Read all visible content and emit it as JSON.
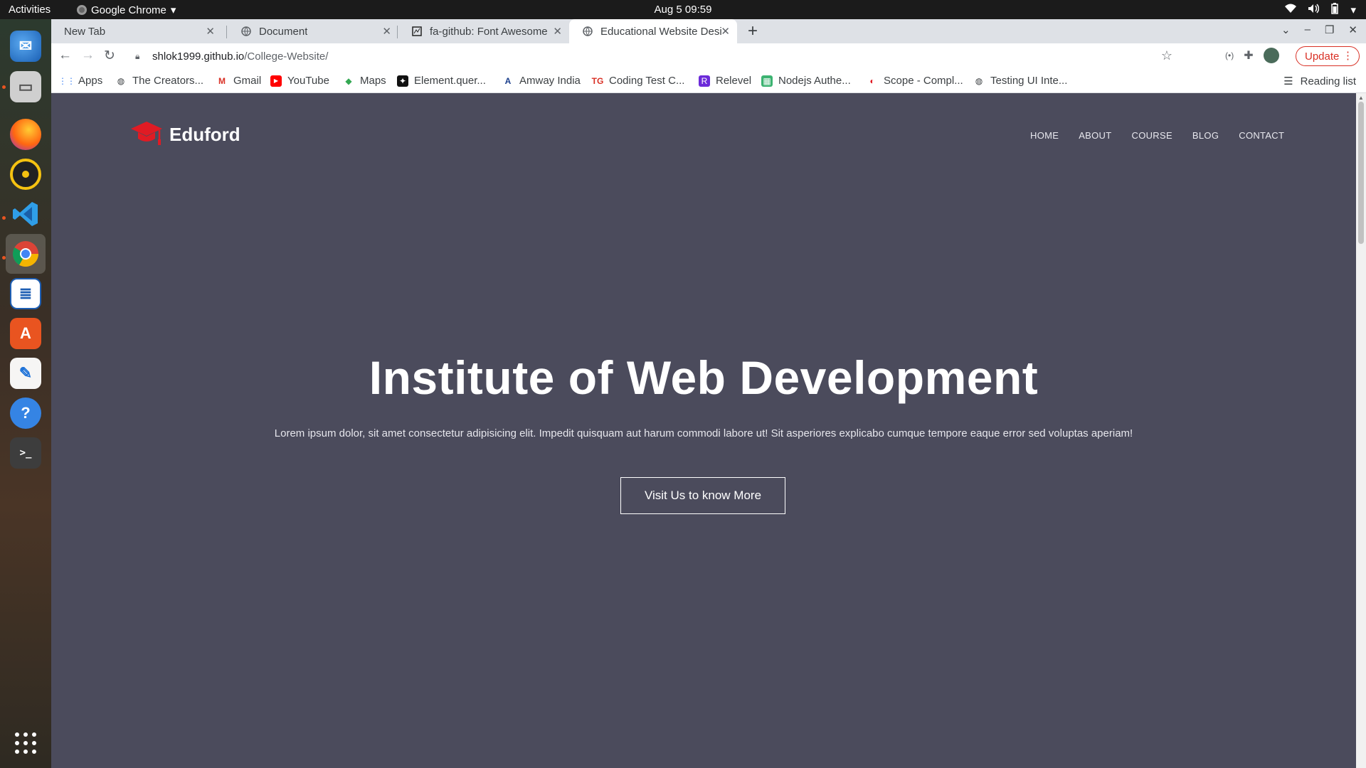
{
  "os": {
    "activities": "Activities",
    "app_name": "Google Chrome",
    "clock": "Aug 5  09:59",
    "tray": [
      "wifi-icon",
      "volume-icon",
      "battery-icon",
      "menu-arrow-icon"
    ]
  },
  "dock": {
    "items": [
      "thunderbird-icon",
      "files-icon",
      "firefox-icon",
      "rhythmbox-icon",
      "vscode-icon",
      "chrome-icon",
      "writer-icon",
      "software-icon",
      "text-editor-icon",
      "help-icon",
      "terminal-icon",
      "app-grid-icon"
    ]
  },
  "tabs": [
    {
      "title": "New Tab"
    },
    {
      "title": "Document"
    },
    {
      "title": "fa-github: Font Awesome"
    },
    {
      "title": "Educational Website Desi"
    }
  ],
  "toolbar": {
    "url_host": "shlok1999.github.io",
    "url_path": "/College-Website/",
    "update_label": "Update"
  },
  "bookmarks": [
    {
      "label": "Apps"
    },
    {
      "label": "The Creators..."
    },
    {
      "label": "Gmail"
    },
    {
      "label": "YouTube"
    },
    {
      "label": "Maps"
    },
    {
      "label": "Element.quer..."
    },
    {
      "label": "Amway India"
    },
    {
      "label": "Coding Test C..."
    },
    {
      "label": "Relevel"
    },
    {
      "label": "Nodejs Authe..."
    },
    {
      "label": "Scope - Compl..."
    },
    {
      "label": "Testing UI Inte..."
    }
  ],
  "reading_list": "Reading list",
  "site": {
    "brand": "Eduford",
    "nav": [
      "HOME",
      "ABOUT",
      "COURSE",
      "BLOG",
      "CONTACT"
    ],
    "hero_title": "Institute of Web Development",
    "hero_subtitle": "Lorem ipsum dolor, sit amet consectetur adipisicing elit. Impedit quisquam aut harum commodi labore ut! Sit asperiores explicabo cumque tempore eaque error sed voluptas aperiam!",
    "cta_label": "Visit Us to know More",
    "colors": {
      "background": "#4b4b5c",
      "logo_red": "#e01b24"
    }
  }
}
